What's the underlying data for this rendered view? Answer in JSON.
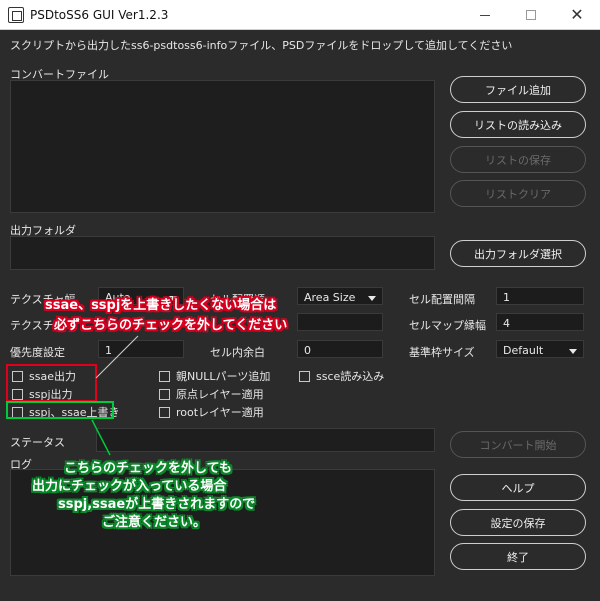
{
  "window": {
    "title": "PSDtoSS6 GUI Ver1.2.3",
    "controls": {
      "minimize": "—",
      "maximize": "□",
      "close": "✕"
    }
  },
  "instructions": "スクリプトから出力したss6-psdtoss6-infoファイル、PSDファイルをドロップして追加してください",
  "convert_files": {
    "label": "コンバートファイル"
  },
  "output_folder": {
    "label": "出力フォルダ"
  },
  "buttons": {
    "add_file": "ファイル追加",
    "load_list": "リストの読み込み",
    "save_list": "リストの保存",
    "clear_list": "リストクリア",
    "select_output": "出力フォルダ選択",
    "start_convert": "コンバート開始",
    "help": "ヘルプ",
    "save_settings": "設定の保存",
    "exit": "終了"
  },
  "settings": {
    "texture_width_label": "テクスチャ幅",
    "texture_width_value": "Auto",
    "texture_height_label": "テクスチ",
    "cell_layout_label": "セル配置順",
    "cell_layout_value": "Area Size",
    "cell_spacing_label": "セル配置間隔",
    "cell_spacing_value": "1",
    "cellmap_border_label": "セルマップ縁幅",
    "cellmap_border_value": "4",
    "priority_label": "優先度設定",
    "priority_value": "1",
    "cell_padding_label": "セル内余白",
    "cell_padding_value": "0",
    "base_frame_label": "基準枠サイズ",
    "base_frame_value": "Default"
  },
  "checkboxes": {
    "ssae_output": "ssae出力",
    "sspj_output": "sspj出力",
    "overwrite": "sspj、ssae上書き",
    "null_parts": "親NULLパーツ追加",
    "origin_layer": "原点レイヤー適用",
    "root_layer": "rootレイヤー適用",
    "ssce_load": "ssce読み込み"
  },
  "status": {
    "label": "ステータス"
  },
  "log": {
    "label": "ログ"
  },
  "annotations": {
    "red_line1": "ssae、sspjを上書きしたくない場合は",
    "red_line2": "必ずこちらのチェックを外してください",
    "green_line1": "こちらのチェックを外しても",
    "green_line2": "出力にチェックが入っている場合",
    "green_line3": "sspj,ssaeが上書きされますので",
    "green_line4": "ご注意ください。"
  },
  "colors": {
    "background": "#2b2b2b",
    "red": "#e0001b",
    "green": "#00c93b"
  }
}
